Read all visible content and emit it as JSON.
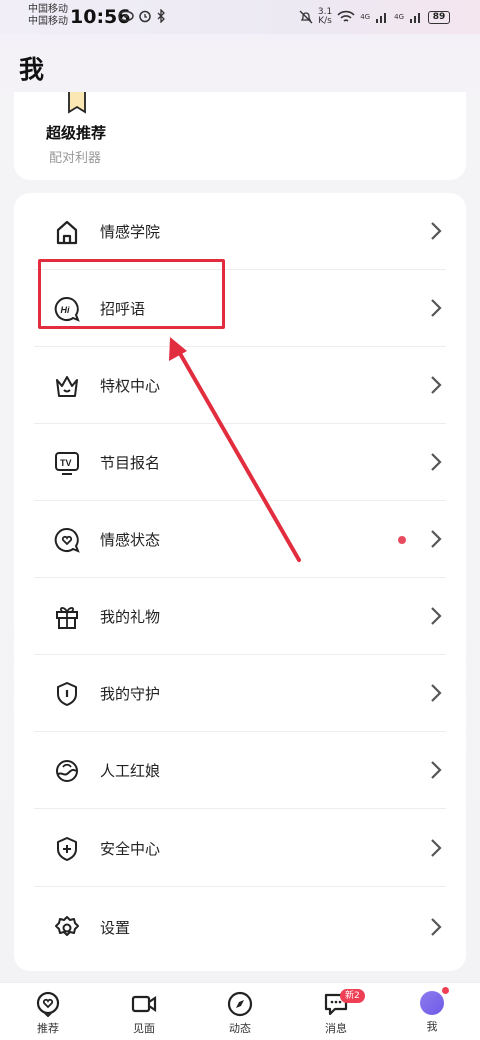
{
  "status_bar": {
    "carrier1": "中国移动",
    "carrier2": "中国移动",
    "time": "10:56",
    "speed_value": "3.1",
    "speed_unit": "K/s",
    "signal_label": "4G",
    "battery": "89"
  },
  "page": {
    "title": "我"
  },
  "recommend_card": {
    "title": "超级推荐",
    "subtitle": "配对利器",
    "icon": "bookmark-ribbon-icon"
  },
  "menu": {
    "items": [
      {
        "label": "情感学院",
        "icon": "house-icon"
      },
      {
        "label": "招呼语",
        "icon": "hi-chat-icon"
      },
      {
        "label": "特权中心",
        "icon": "crown-icon"
      },
      {
        "label": "节目报名",
        "icon": "tv-icon"
      },
      {
        "label": "情感状态",
        "icon": "heart-chat-icon",
        "has_red_dot": true
      },
      {
        "label": "我的礼物",
        "icon": "gift-icon"
      },
      {
        "label": "我的守护",
        "icon": "shield-alert-icon"
      },
      {
        "label": "人工红娘",
        "icon": "matchmaker-icon"
      },
      {
        "label": "安全中心",
        "icon": "shield-plus-icon"
      },
      {
        "label": "设置",
        "icon": "gear-icon"
      }
    ]
  },
  "annotation": {
    "highlight_color": "#e22d3f"
  },
  "tabbar": {
    "tabs": [
      {
        "label": "推荐",
        "icon": "heart-location-icon"
      },
      {
        "label": "见面",
        "icon": "video-camera-icon"
      },
      {
        "label": "动态",
        "icon": "compass-icon"
      },
      {
        "label": "消息",
        "icon": "chat-icon",
        "badge": "新2"
      },
      {
        "label": "我",
        "icon": "avatar-icon",
        "active": true
      }
    ]
  }
}
